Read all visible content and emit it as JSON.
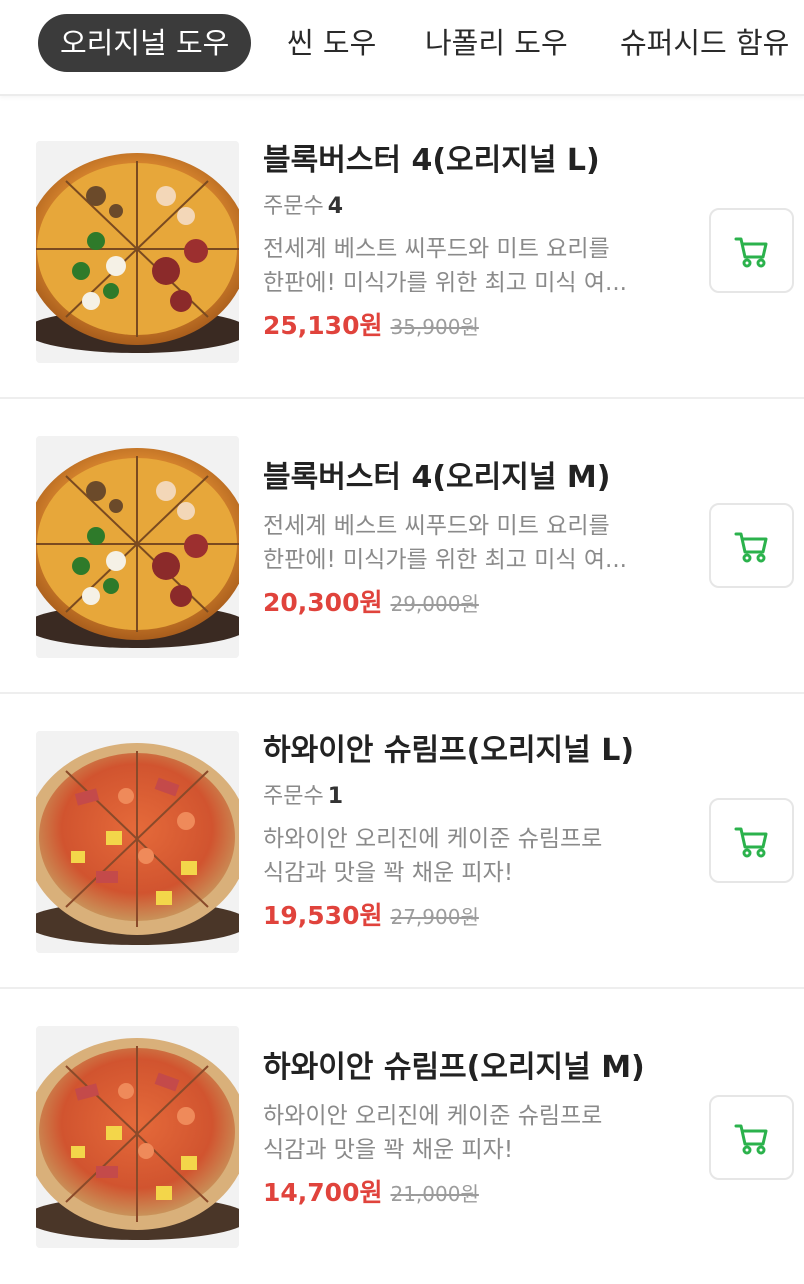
{
  "tabs": [
    {
      "label": "오리지널 도우",
      "active": true
    },
    {
      "label": "씬 도우",
      "active": false
    },
    {
      "label": "나폴리 도우",
      "active": false
    },
    {
      "label": "슈퍼시드 함유",
      "active": false
    }
  ],
  "orders_label": "주문수",
  "items": [
    {
      "name": "블록버스터 4(오리지널 L)",
      "orders": "4",
      "desc_line1": "전세계 베스트 씨푸드와 미트 요리를",
      "desc_line2": "한판에! 미식가를 위한 최고 미식 여...",
      "sale_price": "25,130원",
      "original_price": "35,900원",
      "image_icon": "pizza-blockbuster-image"
    },
    {
      "name": "블록버스터 4(오리지널 M)",
      "desc_line1": "전세계 베스트 씨푸드와 미트 요리를",
      "desc_line2": "한판에! 미식가를 위한 최고 미식 여...",
      "sale_price": "20,300원",
      "original_price": "29,000원",
      "image_icon": "pizza-blockbuster-image"
    },
    {
      "name": "하와이안 슈림프(오리지널 L)",
      "orders": "1",
      "desc_line1": "하와이안 오리진에 케이준 슈림프로",
      "desc_line2": "식감과 맛을 꽉 채운 피자!",
      "sale_price": "19,530원",
      "original_price": "27,900원",
      "image_icon": "pizza-hawaiian-shrimp-image"
    },
    {
      "name": "하와이안 슈림프(오리지널 M)",
      "desc_line1": "하와이안 오리진에 케이준 슈림프로",
      "desc_line2": "식감과 맛을 꽉 채운 피자!",
      "sale_price": "14,700원",
      "original_price": "21,000원",
      "image_icon": "pizza-hawaiian-shrimp-image"
    }
  ],
  "colors": {
    "accent_sale": "#e0433c",
    "cart_icon": "#2bb24c",
    "tab_active_bg": "#3b3b3b"
  },
  "cart_icon": "shopping-cart-icon"
}
